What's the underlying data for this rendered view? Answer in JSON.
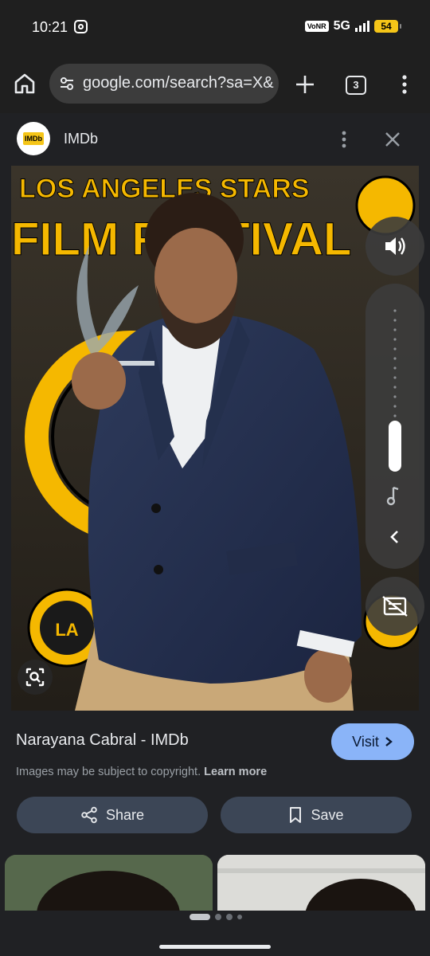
{
  "status_bar": {
    "time": "10:21",
    "volte_badge": "VoNR",
    "network": "5G",
    "battery": "54",
    "icons": [
      "instagram-icon",
      "signal-icon",
      "battery-icon"
    ]
  },
  "browser": {
    "url": "google.com/search?sa=X&",
    "tab_count": "3",
    "icons": [
      "home-icon",
      "site-settings-icon",
      "plus-icon",
      "more-vert-icon"
    ]
  },
  "source": {
    "name": "IMDb",
    "logo_text": "IMDb"
  },
  "photo": {
    "banner_line1": "LOS ANGELES STARS",
    "banner_line2": "FILM FESTIVAL",
    "logo_text": "LA"
  },
  "result": {
    "title": "Narayana Cabral - IMDb",
    "visit_label": "Visit",
    "copyright": "Images may be subject to copyright.",
    "learn_more": "Learn more",
    "share_label": "Share",
    "save_label": "Save"
  },
  "volume": {
    "level": 0.3
  },
  "pager": {
    "active_index": 0,
    "count": 4
  },
  "colors": {
    "accent": "#8ab4f8",
    "imdb_yellow": "#f5c518",
    "background": "#202124"
  }
}
